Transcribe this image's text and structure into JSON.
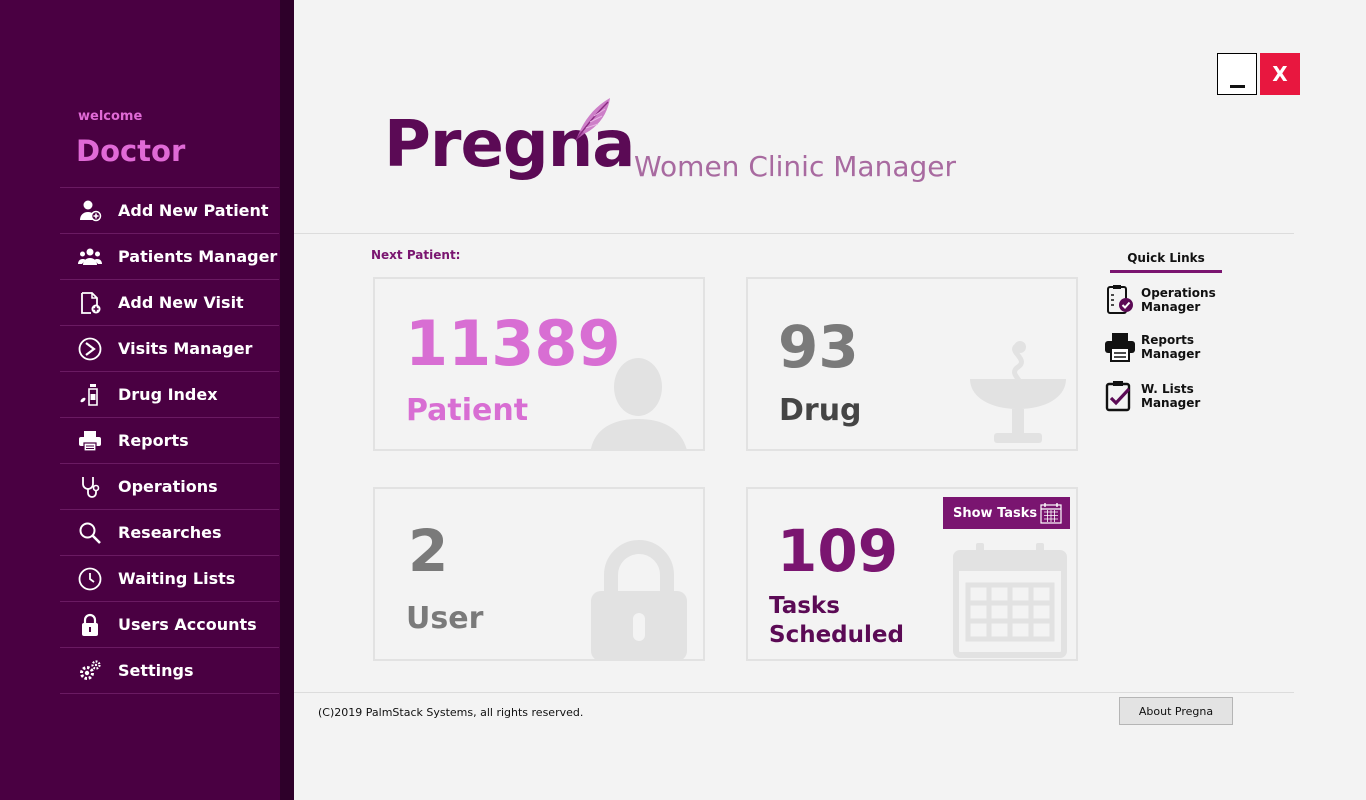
{
  "sidebar": {
    "welcome": "welcome",
    "user_name": "Doctor",
    "items": [
      {
        "label": "Add New Patient",
        "icon": "add-patient-icon"
      },
      {
        "label": "Patients Manager",
        "icon": "patients-group-icon"
      },
      {
        "label": "Add New Visit",
        "icon": "add-visit-icon"
      },
      {
        "label": "Visits Manager",
        "icon": "visits-manager-icon"
      },
      {
        "label": "Drug Index",
        "icon": "drug-index-icon"
      },
      {
        "label": "Reports",
        "icon": "printer-icon"
      },
      {
        "label": "Operations",
        "icon": "stethoscope-icon"
      },
      {
        "label": "Researches",
        "icon": "search-icon"
      },
      {
        "label": "Waiting Lists",
        "icon": "clock-icon"
      },
      {
        "label": "Users Accounts",
        "icon": "lock-icon"
      },
      {
        "label": "Settings",
        "icon": "gear-icon"
      }
    ]
  },
  "window": {
    "minimize": "_",
    "close": "X"
  },
  "logo": {
    "name": "Pregna",
    "subtitle": "Women Clinic Manager"
  },
  "main": {
    "next_patient_label": "Next Patient:",
    "cards": {
      "patient": {
        "value": "11389",
        "label": "Patient"
      },
      "drug": {
        "value": "93",
        "label": "Drug"
      },
      "user": {
        "value": "2",
        "label": "User"
      },
      "tasks": {
        "value": "109",
        "label_line1": "Tasks",
        "label_line2": "Scheduled",
        "button": "Show Tasks"
      }
    }
  },
  "quick_links": {
    "title": "Quick Links",
    "items": [
      {
        "line1": "Operations",
        "line2": "Manager",
        "icon": "clipboard-check-icon"
      },
      {
        "line1": "Reports",
        "line2": "Manager",
        "icon": "printer-icon"
      },
      {
        "line1": "W. Lists",
        "line2": "Manager",
        "icon": "checklist-icon"
      }
    ]
  },
  "footer": {
    "copyright": "(C)2019 PalmStack Systems, all rights reserved.",
    "about_button": "About Pregna"
  },
  "colors": {
    "sidebar": "#4a0042",
    "accent": "#7a1570",
    "pink": "#e06ad6",
    "close": "#e8173f"
  }
}
